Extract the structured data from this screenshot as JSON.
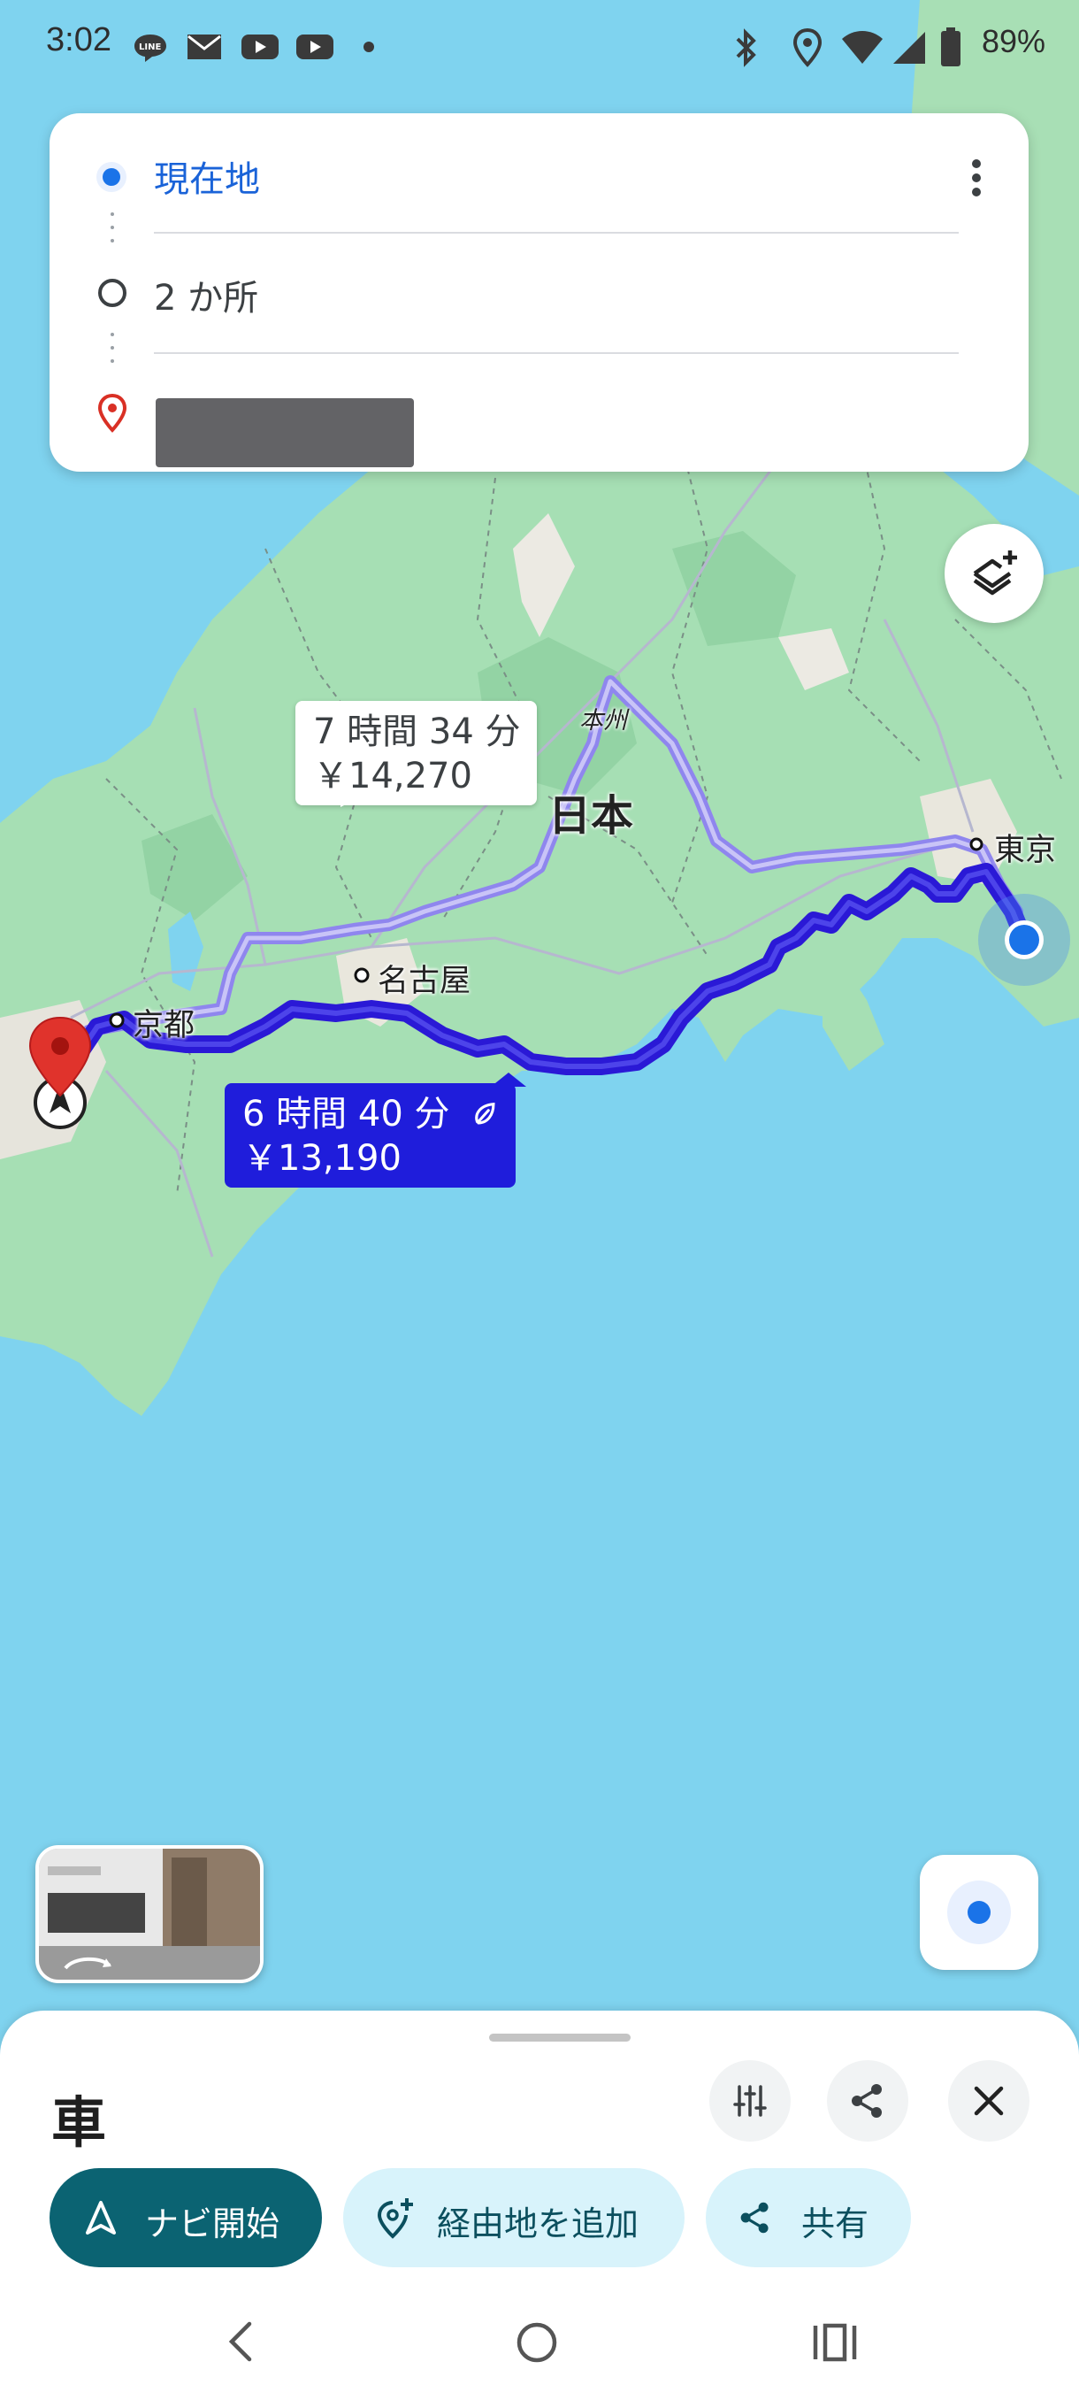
{
  "status_bar": {
    "time": "3:02",
    "battery": "89%",
    "notification_icons": [
      "line-icon",
      "mail-icon",
      "youtube-icon",
      "youtube-icon",
      "dot-icon"
    ],
    "system_icons": [
      "bluetooth-icon",
      "location-icon",
      "wifi-icon",
      "signal-icon",
      "battery-icon"
    ]
  },
  "directions": {
    "origin": "現在地",
    "stops": "2 か所",
    "destination": ""
  },
  "map": {
    "region_label": "本州",
    "country_label": "日本",
    "cities": {
      "tokyo": "東京",
      "nagoya": "名古屋",
      "kyoto": "京都"
    },
    "origin_marker": "A",
    "routes": [
      {
        "duration": "7 時間 34 分",
        "toll": "￥14,270",
        "selected": false
      },
      {
        "duration": "6 時間 40 分",
        "toll": "￥13,190",
        "selected": true,
        "eco": true
      }
    ],
    "colors": {
      "water": "#7fd3ef",
      "land": "#a5dfb3",
      "route_selected": "#2a19d6",
      "route_alt": "#8a7fe6"
    }
  },
  "bottom_sheet": {
    "mode": "車",
    "buttons": {
      "start_nav": "ナビ開始",
      "add_stop": "経由地を追加",
      "share": "共有"
    },
    "icons": [
      "tune-icon",
      "share-icon",
      "close-icon"
    ],
    "colors": {
      "primary": "#0b6372",
      "chip_bg": "#d8f3fb",
      "chip_text": "#0b4f5e"
    }
  },
  "nav_bar": {
    "icons": [
      "back-icon",
      "home-icon",
      "recents-icon"
    ]
  }
}
